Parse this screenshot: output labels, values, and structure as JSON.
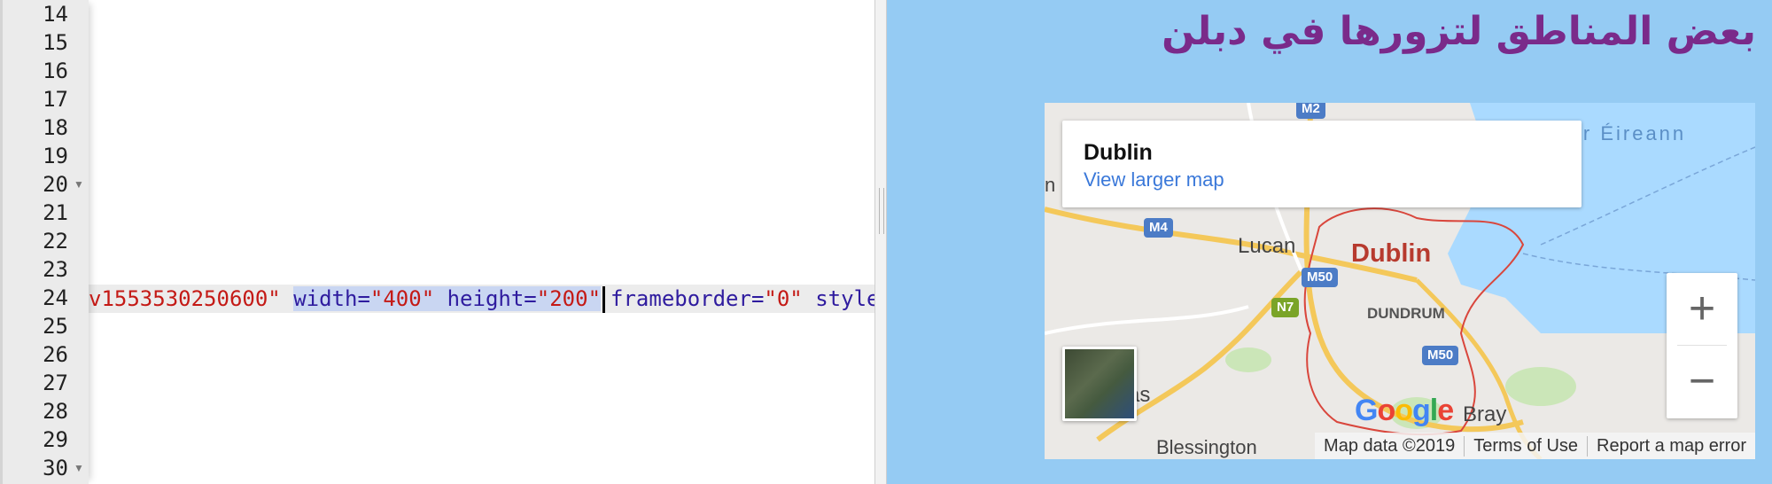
{
  "editor": {
    "line_numbers": [
      "14",
      "15",
      "16",
      "17",
      "18",
      "19",
      "20",
      "21",
      "22",
      "23",
      "24",
      "25",
      "26",
      "27",
      "28",
      "29",
      "30"
    ],
    "current_line": "24",
    "code_line": {
      "pre_value": "v1553530250600\"",
      "width_attr": "width=",
      "width_value": "\"400\"",
      "height_attr": "height=",
      "height_value": "\"200\"",
      "frameborder_attr": "frameborder=",
      "frameborder_value": "\"0\"",
      "style_attr": "style"
    },
    "colors": {
      "attribute": "#2f1c9f",
      "value": "#c41a16",
      "selection": "#c9d6f2"
    }
  },
  "preview": {
    "background": "#95cbf3",
    "heading": "بعض المناطق لتزورها في دبلن",
    "heading_color": "#7a2a8a",
    "map": {
      "info_card": {
        "place_name": "Dublin",
        "link": "View larger map"
      },
      "labels": {
        "city": "Dublin",
        "lucan": "Lucan",
        "dundrum": "DUNDRUM",
        "bray": "Bray",
        "blessington": "Blessington",
        "naas_fragment": "as",
        "sea_fragment": "ir Éireann",
        "west_fragment": "n"
      },
      "road_shields": {
        "m2": "M2",
        "m4": "M4",
        "m50_a": "M50",
        "m50_b": "M50",
        "n7": "N7"
      },
      "zoom_in": "+",
      "zoom_out": "−",
      "logo": [
        "G",
        "o",
        "o",
        "g",
        "l",
        "e"
      ],
      "footer": {
        "data": "Map data ©2019",
        "terms": "Terms of Use",
        "report": "Report a map error"
      }
    }
  }
}
